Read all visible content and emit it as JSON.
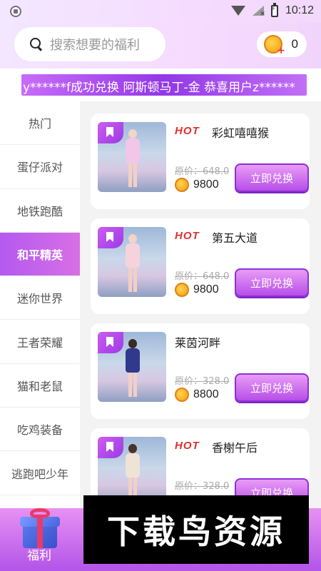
{
  "status": {
    "time": "10:12"
  },
  "search": {
    "placeholder": "搜索想要的福利"
  },
  "wallet": {
    "coins": "0"
  },
  "marquee": {
    "text": "y******f成功兑换 阿斯顿马丁-金   恭喜用户z******"
  },
  "sidebar": {
    "items": [
      "热门",
      "蛋仔派对",
      "地铁跑酷",
      "和平精英",
      "迷你世界",
      "王者荣耀",
      "猫和老鼠",
      "吃鸡装备",
      "逃跑吧少年"
    ],
    "active_index": 3
  },
  "cards": [
    {
      "hot": "HOT",
      "title": "彩虹嘻嘻猴",
      "original": "原价：648.0",
      "price": "9800",
      "button": "立即兑换",
      "outfit_color": "#f2c6e9"
    },
    {
      "hot": "HOT",
      "title": "第五大道",
      "original": "原价：648.0",
      "price": "9800",
      "button": "立即兑换",
      "outfit_color": "#f6d2dd"
    },
    {
      "hot": "",
      "title": "莱茵河畔",
      "original": "原价：328.0",
      "price": "8800",
      "button": "立即兑换",
      "outfit_color": "#2f3a8c"
    },
    {
      "hot": "HOT",
      "title": "香榭午后",
      "original": "原价：328.0",
      "price": "",
      "button": "立即兑换",
      "outfit_color": "#efe3d6"
    }
  ],
  "tabbar": {
    "welfare": "福利"
  },
  "watermark": {
    "text": "下载鸟资源"
  },
  "colors": {
    "accent": "#b64fe8",
    "hot": "#e02f2f"
  }
}
